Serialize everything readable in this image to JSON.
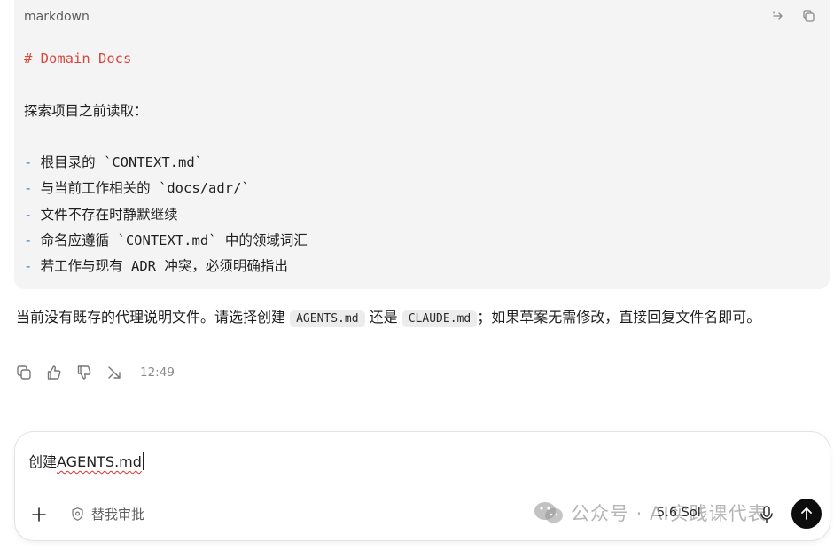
{
  "code_block": {
    "language": "markdown",
    "lines": [
      {
        "kind": "heading",
        "text": "# Domain Docs"
      },
      {
        "kind": "blank",
        "text": ""
      },
      {
        "kind": "text",
        "text": "探索项目之前读取："
      },
      {
        "kind": "blank",
        "text": ""
      },
      {
        "kind": "bullet",
        "marker": "-",
        "text": " 根目录的 `CONTEXT.md`"
      },
      {
        "kind": "bullet",
        "marker": "-",
        "text": " 与当前工作相关的 `docs/adr/`"
      },
      {
        "kind": "bullet",
        "marker": "-",
        "text": " 文件不存在时静默继续"
      },
      {
        "kind": "bullet",
        "marker": "-",
        "text": " 命名应遵循 `CONTEXT.md` 中的领域词汇"
      },
      {
        "kind": "bullet",
        "marker": "-",
        "text": " 若工作与现有 ADR 冲突，必须明确指出"
      }
    ]
  },
  "message": {
    "part1": "当前没有既存的代理说明文件。请选择创建 ",
    "code1": "AGENTS.md",
    "part2": " 还是 ",
    "code2": "CLAUDE.md",
    "part3": "；如果草案无需修改，直接回复文件名即可。"
  },
  "message_actions": {
    "time": "12:49"
  },
  "composer": {
    "prefix": "创建",
    "spell_word": "AGENTS.md",
    "approval_label": "替我审批",
    "model_label": "5.6 Sol"
  },
  "watermark": {
    "text": "公众号 · AI实践课代表"
  },
  "colors": {
    "code_bg": "#f4f4f4",
    "heading": "#d9473b",
    "bullet": "#3f7fc4",
    "send_bg": "#0d0d0d"
  }
}
